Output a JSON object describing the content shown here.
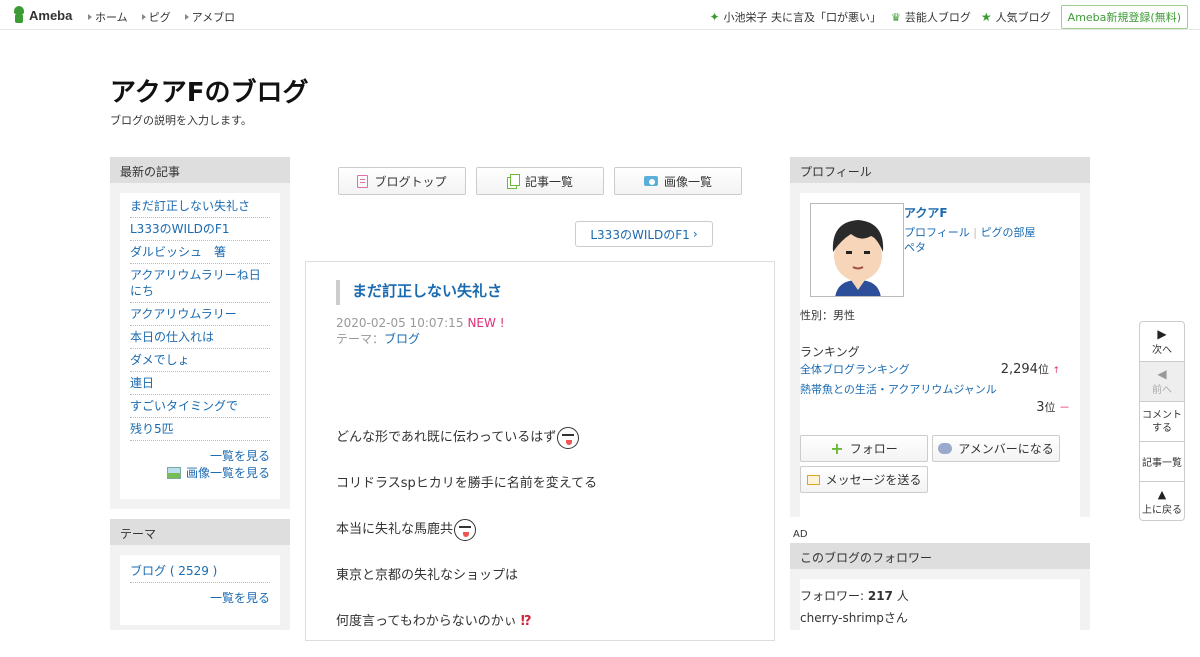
{
  "topbar": {
    "logo_text": "Ameba",
    "nav": [
      "ホーム",
      "ピグ",
      "アメブロ"
    ],
    "trending": "小池栄子 夫に言及「口が悪い」",
    "celeb_blog": "芸能人ブログ",
    "popular_blog": "人気ブログ",
    "register": "Ameba新規登録(無料)"
  },
  "blog": {
    "title": "アクアFのブログ",
    "description": "ブログの説明を入力します。"
  },
  "recent": {
    "heading": "最新の記事",
    "items": [
      "まだ訂正しない失礼さ",
      "L333のWILDのF1",
      "ダルビッシュ　箸",
      "アクアリウムラリーね日にち",
      "アクアリウムラリー",
      "本日の仕入れは",
      "ダメでしょ",
      "連日",
      "すごいタイミングで",
      "残り5匹"
    ],
    "more": "一覧を見る",
    "images_more": "画像一覧を見る"
  },
  "theme": {
    "heading": "テーマ",
    "item": "ブログ ( 2529 )",
    "more": "一覧を見る"
  },
  "center": {
    "btn_top": "ブログトップ",
    "btn_list": "記事一覧",
    "btn_images": "画像一覧",
    "next_post": "L333のWILDのF1",
    "article": {
      "title": "まだ訂正しない失礼さ",
      "date": "2020-02-05 10:07:15",
      "new": "NEW !",
      "theme_label": "テーマ：",
      "theme": "ブログ",
      "lines": [
        "どんな形であれ既に伝わっているはず",
        "コリドラスspヒカリを勝手に名前を変えてる",
        "本当に失礼な馬鹿共",
        "東京と京都の失礼なショップは",
        "何度言ってもわからないのかぃ"
      ],
      "exclaim": "⁉"
    }
  },
  "profile": {
    "heading": "プロフィール",
    "name": "アクアF",
    "profile_link": "プロフィール",
    "pigg_link": "ピグの部屋",
    "peta_link": "ペタ",
    "gender": "性別：男性",
    "ranking_label": "ランキング",
    "overall_label": "全体ブログランキング",
    "overall_rank": "2,294",
    "overall_unit": "位",
    "overall_trend": "↑",
    "genre_label": "熱帯魚との生活・アクアリウムジャンル",
    "genre_rank": "3",
    "genre_unit": "位",
    "genre_trend": "－",
    "follow_btn": "フォロー",
    "member_btn": "アメンバーになる",
    "message_btn": "メッセージを送る",
    "ad": "AD"
  },
  "followers": {
    "heading": "このブログのフォロワー",
    "label": "フォロワー: ",
    "count": "217",
    "unit": " 人",
    "first": "cherry-shrimpさん"
  },
  "floatnav": {
    "next": "次へ",
    "prev": "前へ",
    "comment": "コメントする",
    "list": "記事一覧",
    "top": "上に戻る"
  }
}
